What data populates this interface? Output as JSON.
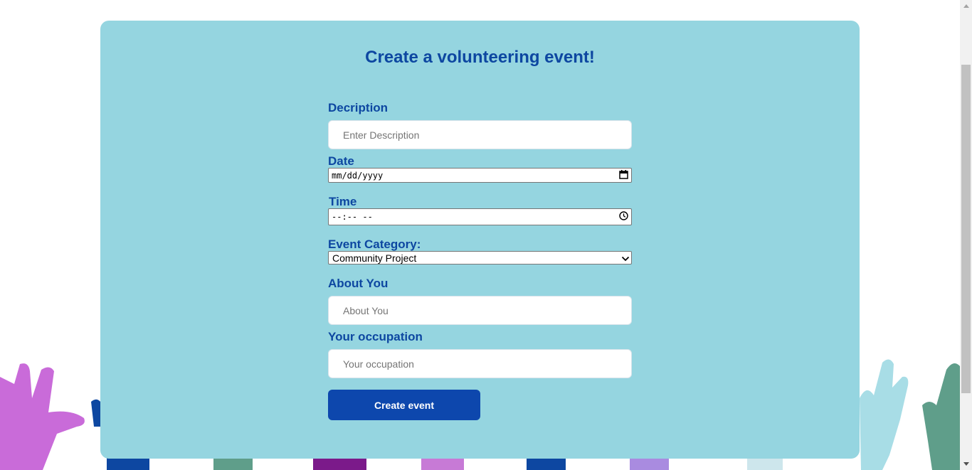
{
  "page": {
    "title": "Create a volunteering event!"
  },
  "form": {
    "description_label": "Decription",
    "description_placeholder": "Enter Description",
    "date_label": "Date",
    "date_value": "mm/dd/yyyy",
    "time_label": "Time",
    "time_value": "--:-- --",
    "category_label": "Event Category:",
    "category_value": "Community Project",
    "about_label": "About You",
    "about_placeholder": "About You",
    "occupation_label": "Your occupation",
    "occupation_placeholder": "Your occupation",
    "submit_label": "Create event"
  },
  "icons": {
    "date": "calendar-icon",
    "time": "clock-icon",
    "select": "chevron-down-icon"
  },
  "colors": {
    "card_bg": "#95d5e0",
    "heading": "#0d47a1",
    "button_bg": "#0d47ad",
    "button_text": "#ffffff"
  }
}
